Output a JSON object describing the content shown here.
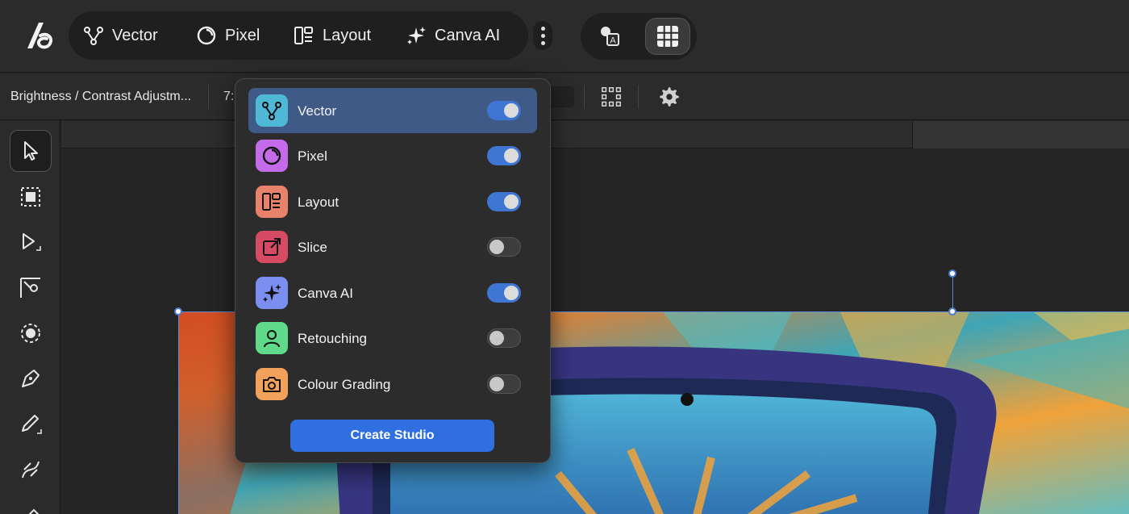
{
  "studios_bar": {
    "items": [
      {
        "label": "Vector",
        "icon": "vector-icon"
      },
      {
        "label": "Pixel",
        "icon": "pixel-icon"
      },
      {
        "label": "Layout",
        "icon": "layout-icon"
      },
      {
        "label": "Canva AI",
        "icon": "sparkles-icon"
      }
    ]
  },
  "context_bar": {
    "tool_label": "Brightness / Contrast Adjustm...",
    "truncated_value": "7:"
  },
  "dropdown": {
    "items": [
      {
        "label": "Vector",
        "enabled": true,
        "icon": "vector-icon",
        "color": "#4fb8d6"
      },
      {
        "label": "Pixel",
        "enabled": true,
        "icon": "pixel-icon",
        "color": "#c36be8"
      },
      {
        "label": "Layout",
        "enabled": true,
        "icon": "layout-icon",
        "color": "#e8826a"
      },
      {
        "label": "Slice",
        "enabled": false,
        "icon": "export-icon",
        "color": "#d64b63"
      },
      {
        "label": "Canva AI",
        "enabled": true,
        "icon": "sparkles-icon",
        "color": "#7a8ff0"
      },
      {
        "label": "Retouching",
        "enabled": false,
        "icon": "person-icon",
        "color": "#5fd98a"
      },
      {
        "label": "Colour Grading",
        "enabled": false,
        "icon": "camera-icon",
        "color": "#f2a15a"
      }
    ],
    "create_button": "Create Studio"
  },
  "colors": {
    "accent": "#3f76d4",
    "selection": "#405a87",
    "background": "#232323"
  }
}
